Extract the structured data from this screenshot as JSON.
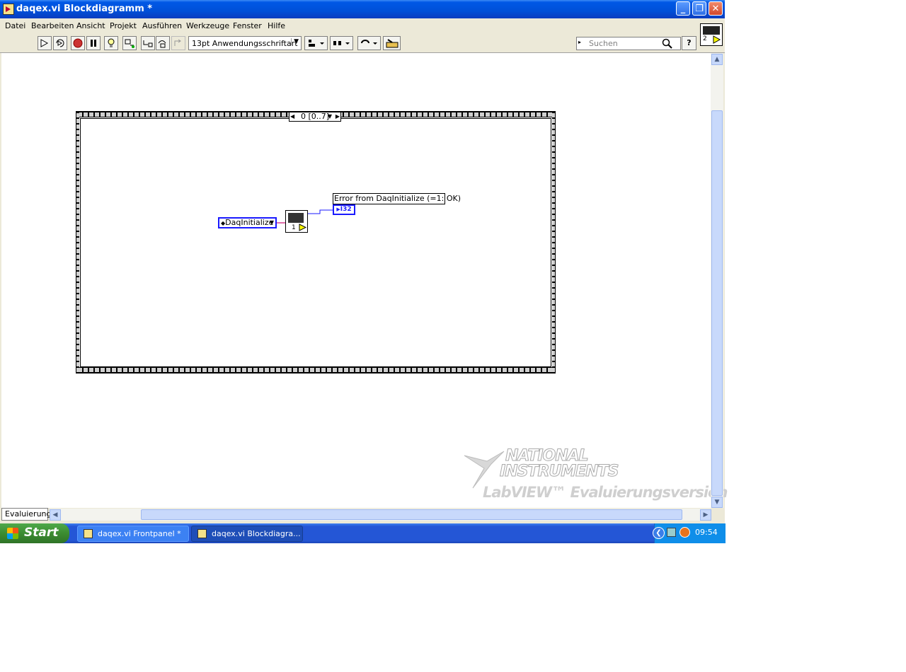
{
  "window": {
    "title": "daqex.vi Blockdiagramm *",
    "minimize_glyph": "_",
    "restore_glyph": "❐",
    "close_glyph": "✕"
  },
  "menu": {
    "items": [
      {
        "label": "Datei"
      },
      {
        "label": "Bearbeiten"
      },
      {
        "label": "Ansicht"
      },
      {
        "label": "Projekt"
      },
      {
        "label": "Ausführen"
      },
      {
        "label": "Werkzeuge"
      },
      {
        "label": "Fenster"
      },
      {
        "label": "Hilfe"
      }
    ]
  },
  "toolbar": {
    "font_selector": "13pt Anwendungsschriftart",
    "search_placeholder": "Suchen",
    "help_glyph": "?",
    "connector_pane_number": "2"
  },
  "diagram": {
    "frame_selector": "0 [0..7]",
    "ring_constant": "DaqInitialize",
    "subvi_number": "1",
    "indicator_label": "Error from DaqInitialize (=1: OK)",
    "indicator_type": "I32"
  },
  "watermark": {
    "line1": "NATIONAL",
    "line2": "INSTRUMENTS",
    "line3": "LabVIEW™ Evaluierungsversion"
  },
  "status_tab": "Evaluierung",
  "taskbar": {
    "start_label": "Start",
    "tasks": [
      {
        "label": "daqex.vi Frontpanel *",
        "active": false
      },
      {
        "label": "daqex.vi Blockdiagra...",
        "active": true
      }
    ],
    "clock": "09:54"
  },
  "colors": {
    "titlebar": "#0050d8",
    "wire_blue": "#1a1aff",
    "wire_pink": "#d23c8c"
  }
}
